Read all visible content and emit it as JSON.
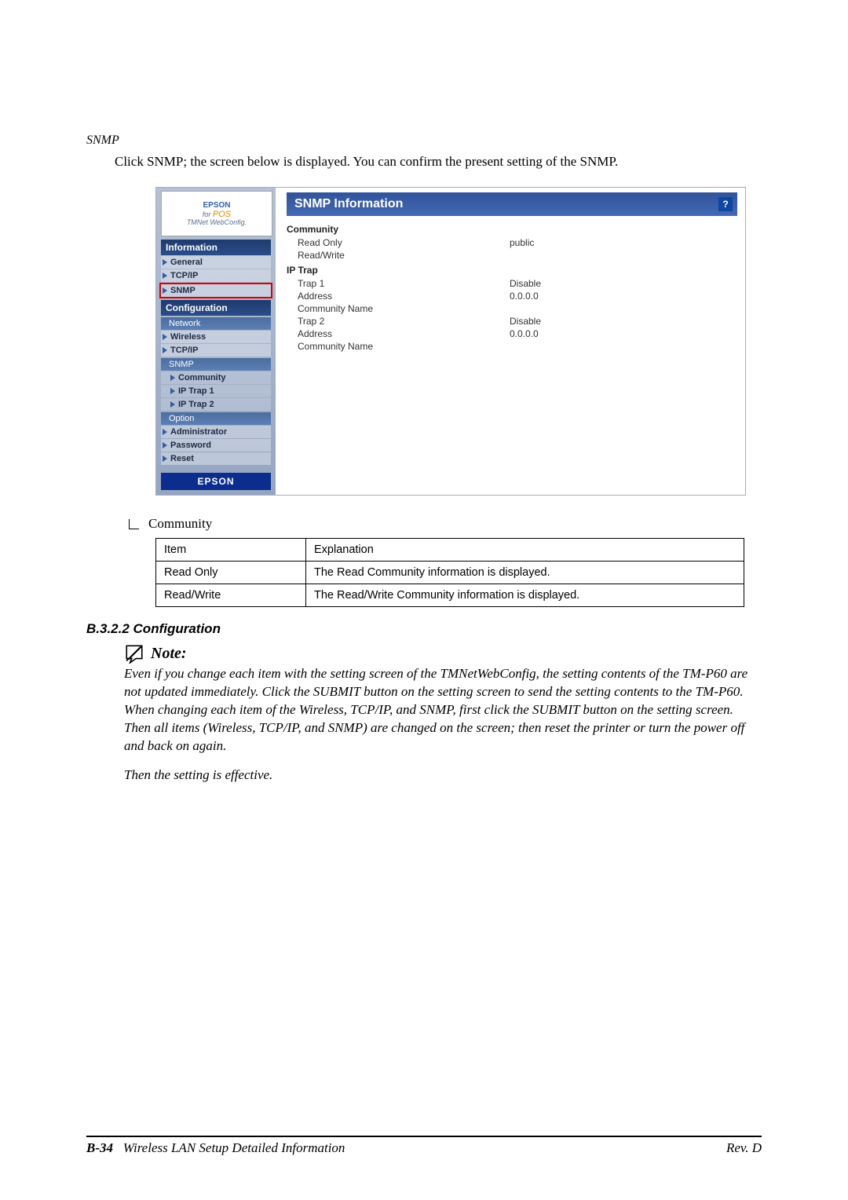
{
  "doc": {
    "snmp_heading": "SNMP",
    "intro": "Click SNMP; the screen below is displayed. You can confirm the present setting of the SNMP."
  },
  "webconfig": {
    "logo": {
      "epson": "EPSON",
      "for": "for",
      "pos": "POS",
      "name": "TMNet WebConfig."
    },
    "sections": {
      "info_header": "Information",
      "info_items": {
        "general": "General",
        "tcpip": "TCP/IP",
        "snmp": "SNMP"
      },
      "config_header": "Configuration",
      "config_cat_network": "Network",
      "config_items": {
        "wireless": "Wireless",
        "tcpip": "TCP/IP",
        "snmp": "SNMP"
      },
      "snmp_children": {
        "community": "Community",
        "iptrap1": "IP Trap 1",
        "iptrap2": "IP Trap 2"
      },
      "config_cat_option": "Option",
      "option_items": {
        "admin": "Administrator",
        "password": "Password",
        "reset": "Reset"
      }
    },
    "epson_badge": "EPSON",
    "main": {
      "title": "SNMP Information",
      "help": "?",
      "group_community": "Community",
      "community_rows": [
        {
          "k": "Read Only",
          "v": "public"
        },
        {
          "k": "Read/Write",
          "v": ""
        }
      ],
      "group_iptrap": "IP Trap",
      "iptrap_rows": [
        {
          "k": "Trap 1",
          "v": "Disable"
        },
        {
          "k": "Address",
          "v": "0.0.0.0"
        },
        {
          "k": "Community Name",
          "v": ""
        },
        {
          "k": "Trap 2",
          "v": "Disable"
        },
        {
          "k": "Address",
          "v": "0.0.0.0"
        },
        {
          "k": "Community Name",
          "v": ""
        }
      ]
    }
  },
  "bullet_community": "Community",
  "table": {
    "head": {
      "item": "Item",
      "explanation": "Explanation"
    },
    "rows": [
      {
        "item": "Read Only",
        "explanation": "The Read Community information is displayed."
      },
      {
        "item": "Read/Write",
        "explanation": "The Read/Write Community information is displayed."
      }
    ]
  },
  "section_heading": "B.3.2.2  Configuration",
  "note": {
    "label": "Note:",
    "p1": "Even if you change each item with the setting screen of the TMNetWebConfig, the setting contents of the TM-P60 are not updated immediately. Click the SUBMIT button on the setting screen to send the setting contents to the TM-P60.",
    "p2": "When changing each item of the Wireless, TCP/IP, and SNMP, first click the SUBMIT button on the setting screen. Then all items (Wireless, TCP/IP, and SNMP) are changed on the screen; then reset the printer or turn the power off and back on again.",
    "p3": "Then the setting is effective."
  },
  "footer": {
    "page": "B-34",
    "title": "Wireless LAN Setup Detailed Information",
    "rev": "Rev. D"
  }
}
